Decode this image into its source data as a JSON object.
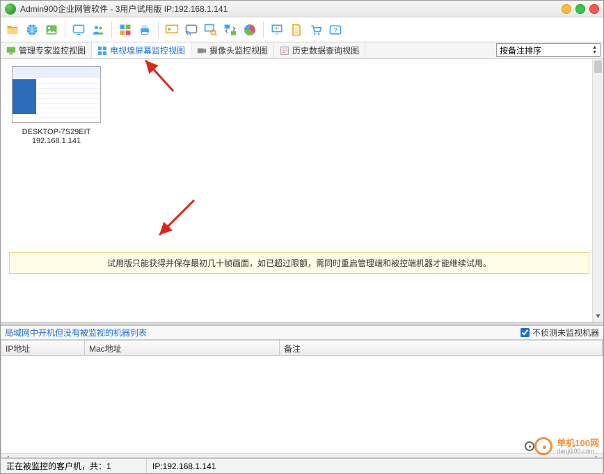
{
  "window": {
    "title": "Admin900企业网管软件 - 3用户试用版 IP:192.168.1.141"
  },
  "tabs": [
    {
      "label": "管理专家监控视图"
    },
    {
      "label": "电视墙屏幕监控视图"
    },
    {
      "label": "摄像头监控视图"
    },
    {
      "label": "历史数据查询视图"
    }
  ],
  "sort": {
    "label": "按备注排序"
  },
  "thumb": {
    "name": "DESKTOP-7S29EIT",
    "ip": "192.168.1.141"
  },
  "notice": {
    "text": "试用版只能获得并保存最初几十帧画面，如已超过限额，需同时重启管理端和被控端机器才能继续试用。"
  },
  "lower": {
    "title": "局域网中开机但没有被监视的机器列表",
    "checkbox": "不侦测未监视机器",
    "columns": {
      "ip": "IP地址",
      "mac": "Mac地址",
      "note": "备注"
    }
  },
  "status": {
    "clients": "正在被监控的客户机，共：1",
    "ip": "IP:192.168.1.141"
  },
  "watermark": {
    "name": "单机100网",
    "url": "danji100.com"
  },
  "icons": {
    "folder": "folder-icon",
    "globe": "globe-icon",
    "image": "image-icon",
    "screen": "screen-icon",
    "users": "users-icon",
    "grid": "grid-icon",
    "printer": "printer-icon",
    "display": "display-icon",
    "cast": "cast-icon",
    "search": "search-icon",
    "swap": "swap-icon",
    "chart": "chart-icon",
    "netpc": "netpc-icon",
    "doc": "doc-icon",
    "cart": "cart-icon",
    "help": "help-icon"
  }
}
